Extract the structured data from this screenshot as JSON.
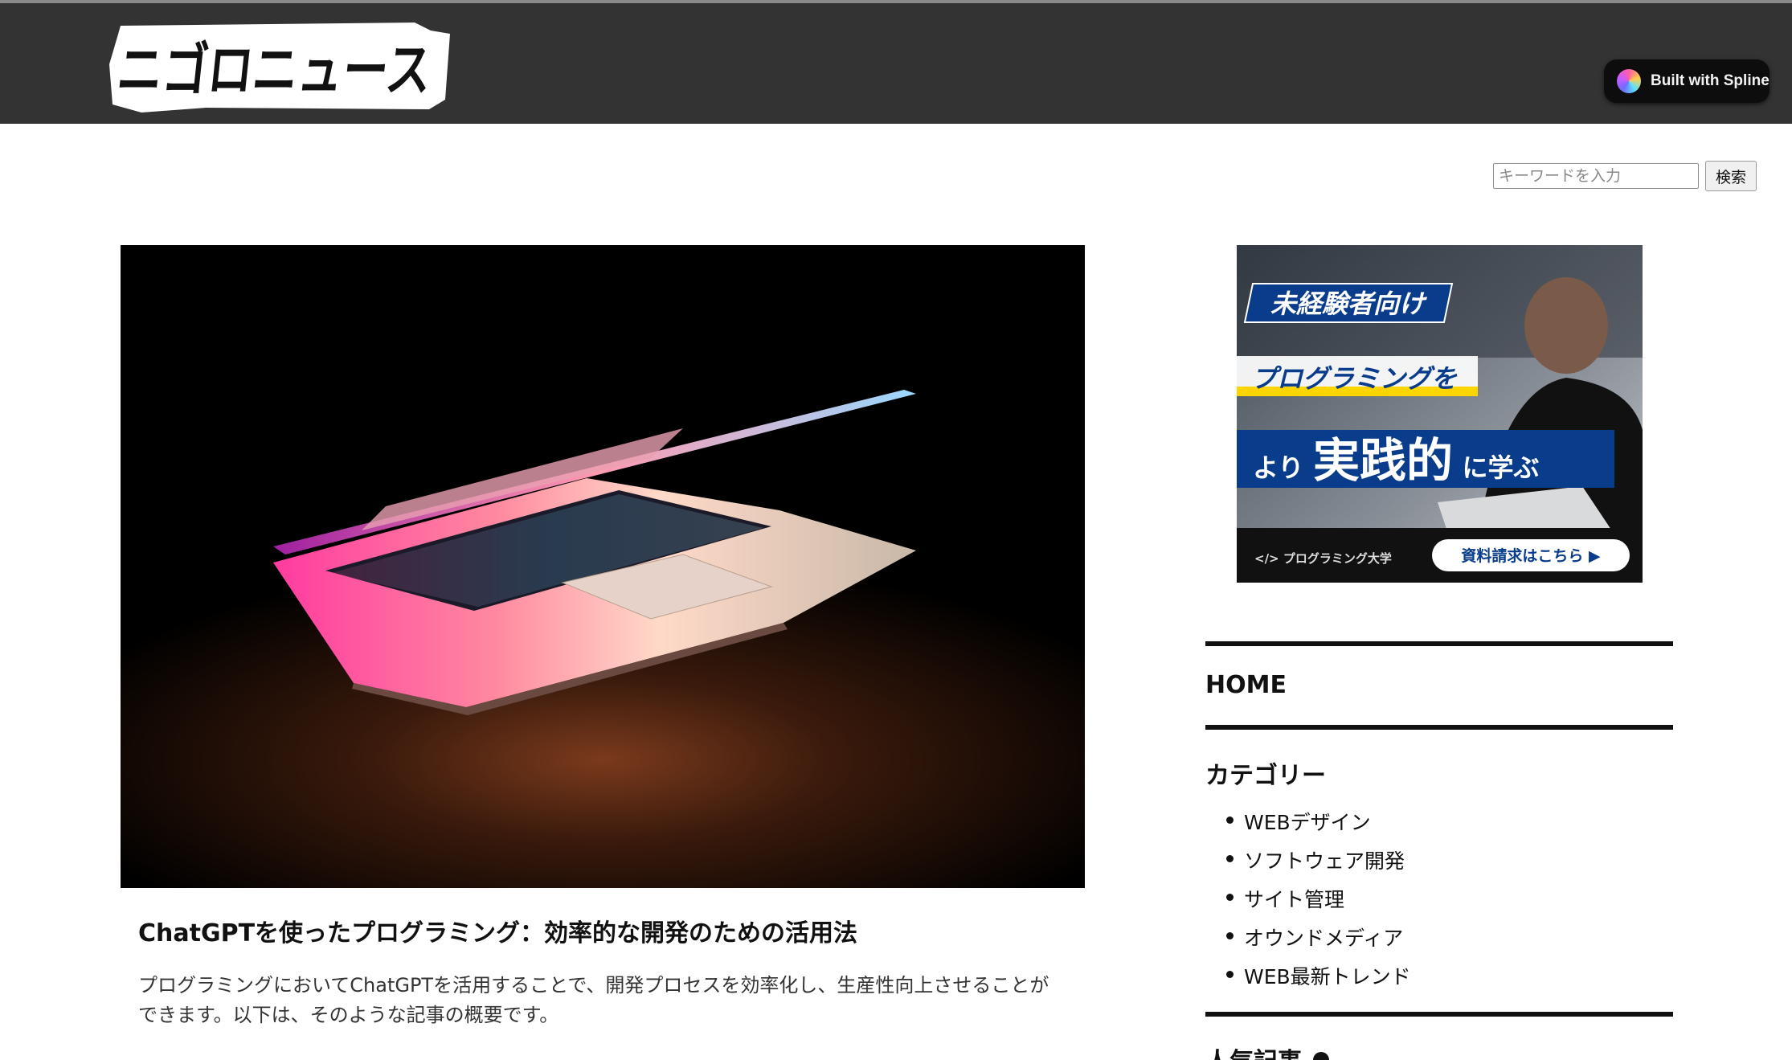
{
  "header": {
    "logo_text": "ニゴロニュース",
    "badge_label": "Built with Spline"
  },
  "search": {
    "placeholder": "キーワードを入力",
    "button_label": "検索"
  },
  "article": {
    "title": "ChatGPTを使ったプログラミング：効率的な開発のための活用法",
    "excerpt": "プログラミングにおいてChatGPTを活用することで、開発プロセスを効率化し、生産性向上させることができます。以下は、そのような記事の概要です。"
  },
  "ad": {
    "tag": "未経験者向け",
    "line1": "プログラミングを",
    "line2_small": "より",
    "line2_big": "実践的",
    "line2_end": "に学ぶ",
    "brand": "</> プログラミング大学",
    "cta": "資料請求はこちら ▶"
  },
  "sidebar": {
    "home_label": "HOME",
    "categories_heading": "カテゴリー",
    "categories": [
      "WEBデザイン",
      "ソフトウェア開発",
      "サイト管理",
      "オウンドメディア",
      "WEB最新トレンド"
    ],
    "popular_heading": "人気記事"
  },
  "colors": {
    "header_bg": "#333333",
    "ad_blue": "#0a3c8c",
    "ad_yellow": "#ffd500"
  }
}
